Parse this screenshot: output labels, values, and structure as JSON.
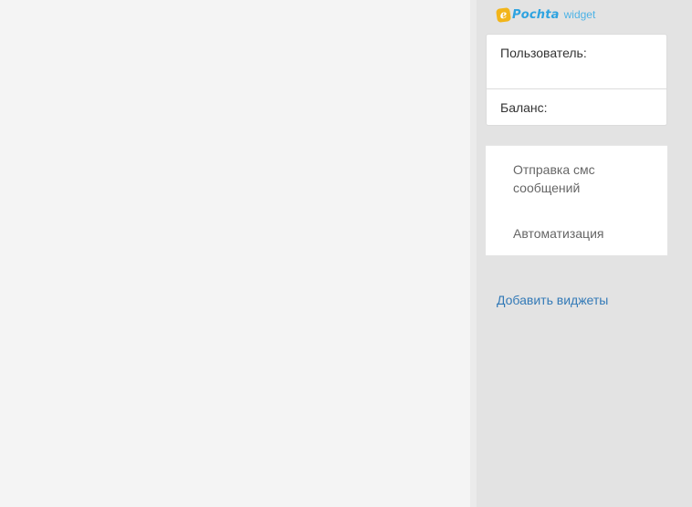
{
  "widget": {
    "logo_letter": "e",
    "logo_name": "Pochta",
    "logo_suffix": "widget"
  },
  "info": {
    "user_label": "Пользователь:",
    "balance_label": "Баланс:"
  },
  "menu": {
    "items": [
      {
        "label": "Отправка смс сообщений"
      },
      {
        "label": "Автоматизация"
      }
    ]
  },
  "add_widgets_link": "Добавить виджеты",
  "colors": {
    "sidebar_bg": "#e3e3e3",
    "main_bg": "#f4f4f4",
    "link": "#337ab7",
    "logo_blue": "#2ea3e0",
    "logo_yellow": "#f2b51a"
  }
}
